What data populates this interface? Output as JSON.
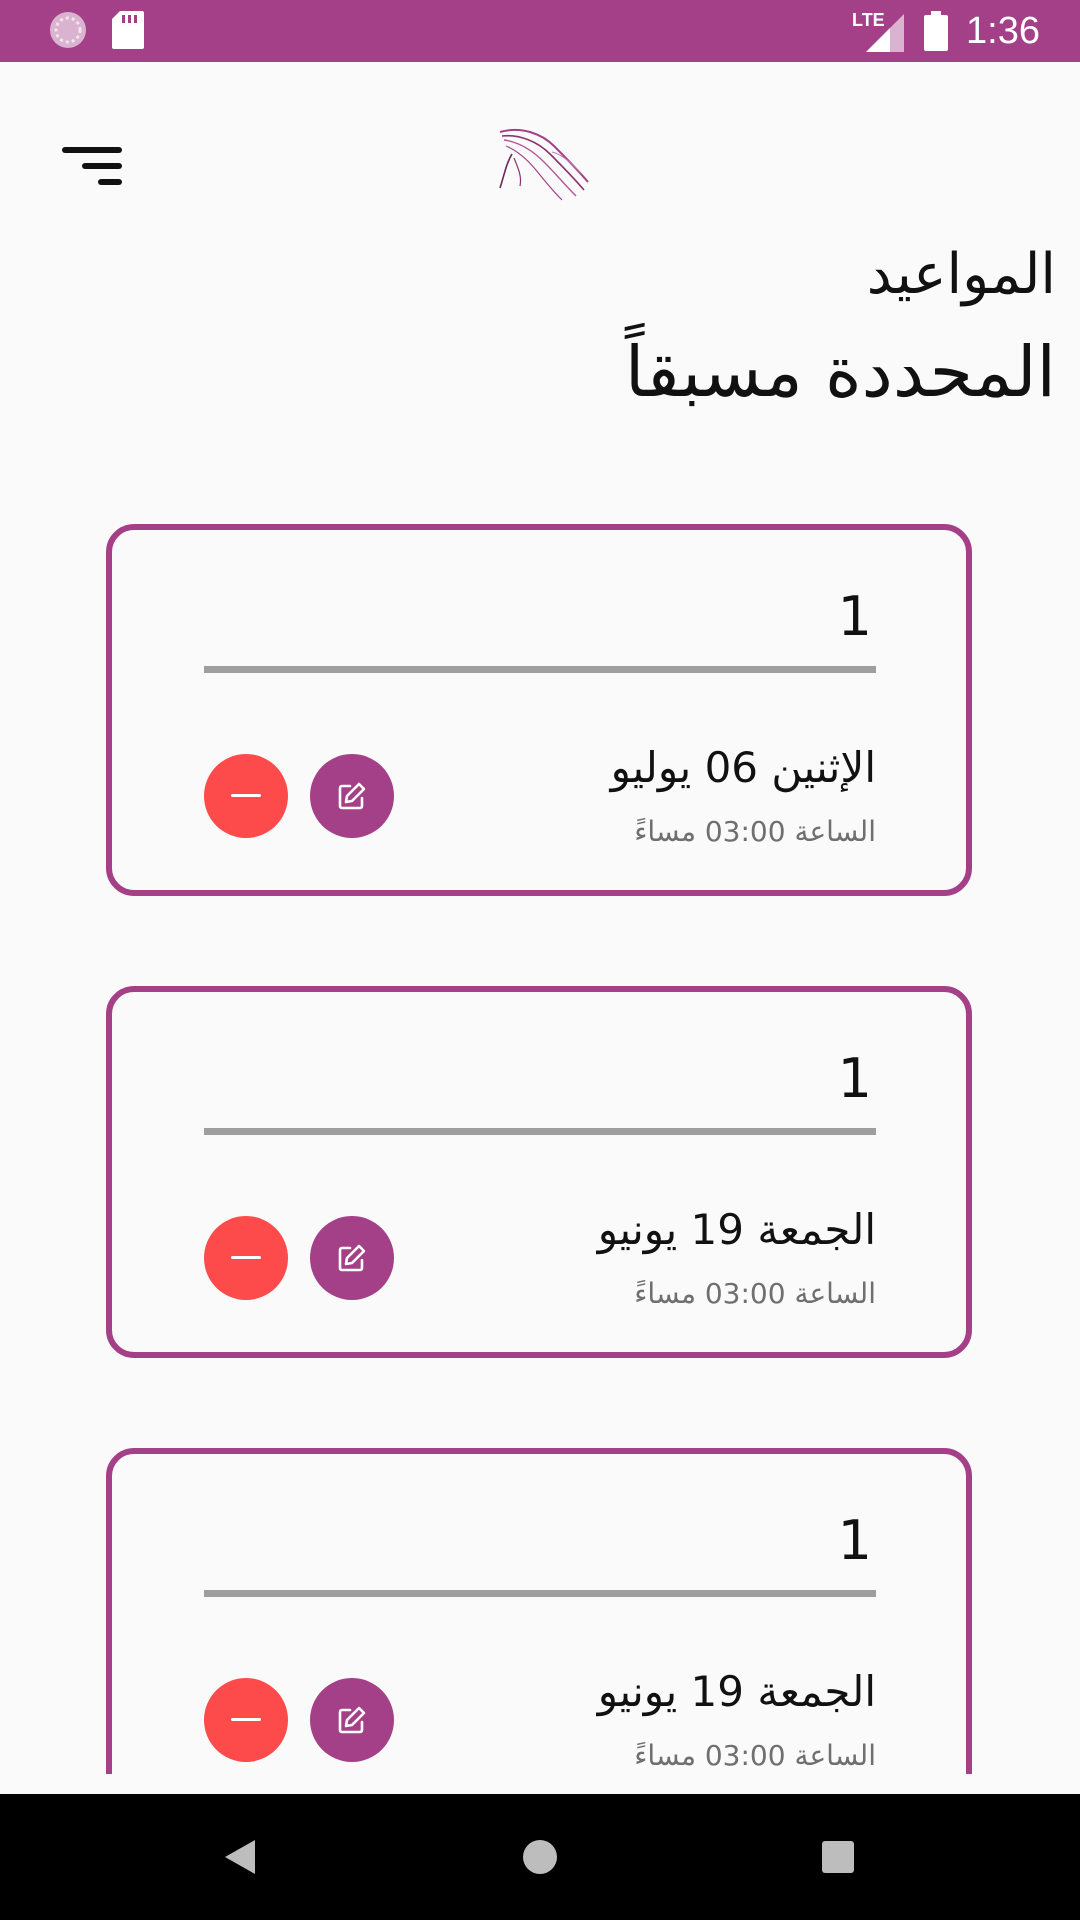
{
  "status_bar": {
    "network": "LTE",
    "time": "1:36"
  },
  "header": {
    "title_line1": "المواعيد",
    "title_line2": "المحددة مسبقاً"
  },
  "appointments": [
    {
      "number": "1",
      "date": "الإثنين 06 يوليو",
      "time": "الساعة 03:00 مساءً"
    },
    {
      "number": "1",
      "date": "الجمعة 19 يونيو",
      "time": "الساعة 03:00 مساءً"
    },
    {
      "number": "1",
      "date": "الجمعة 19 يونيو",
      "time": "الساعة 03:00 مساءً"
    }
  ],
  "icons": {
    "menu": "filter-lines-icon",
    "remove": "minus-icon",
    "edit": "edit-icon"
  },
  "colors": {
    "primary": "#a44087",
    "danger": "#fd4a4a",
    "divider": "#9e9e9e",
    "background": "#fafafa"
  }
}
